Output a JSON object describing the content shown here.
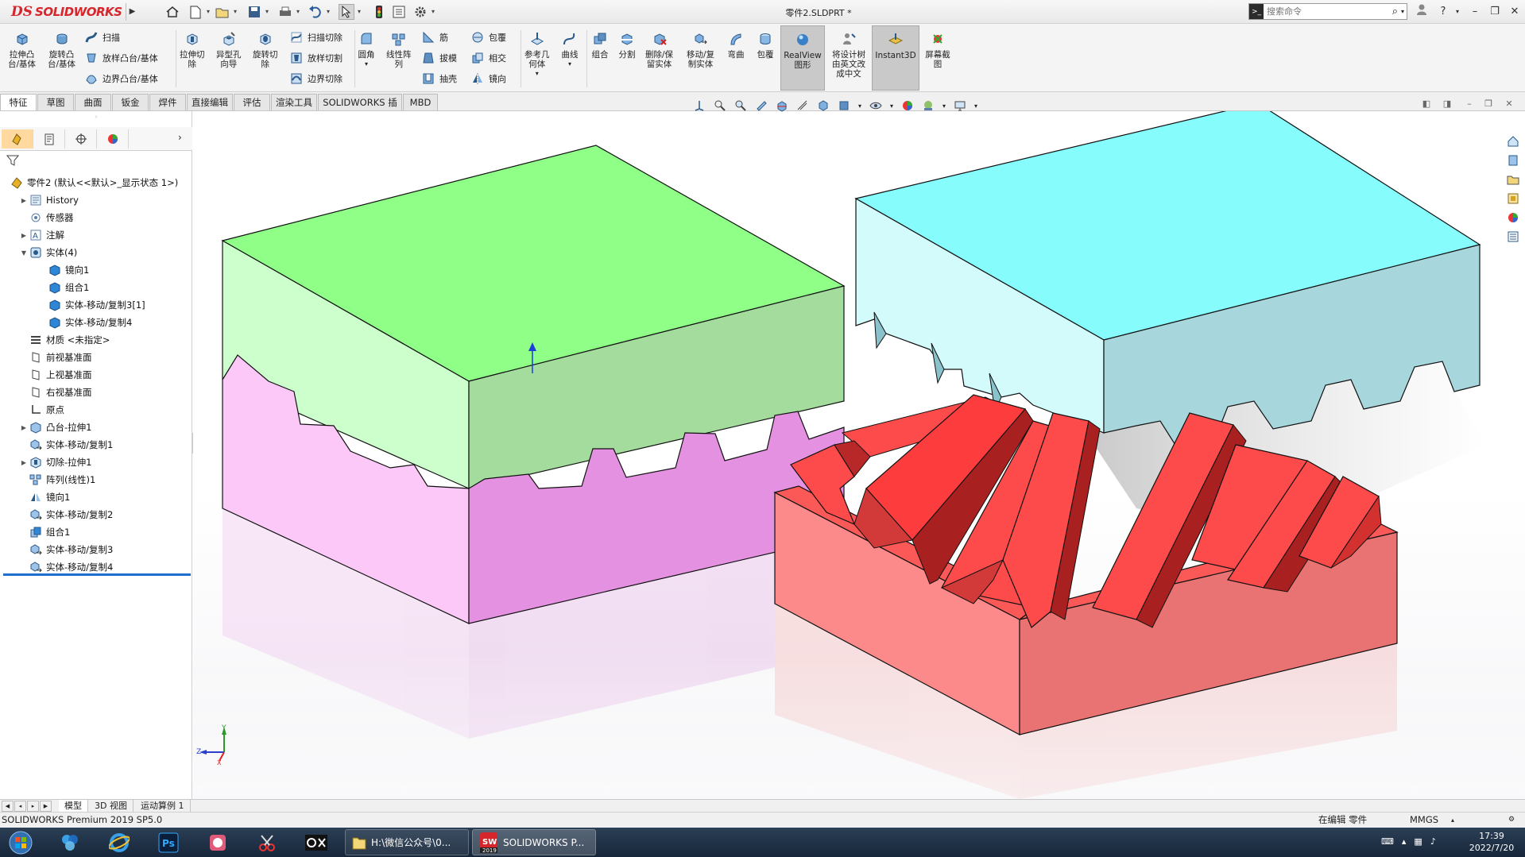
{
  "app": {
    "brand_ds": "DS",
    "brand_name": "SOLIDWORKS",
    "document_title": "零件2.SLDPRT *"
  },
  "search": {
    "placeholder": "搜索命令"
  },
  "commands": {
    "extrude_boss": "拉伸凸\n台/基体",
    "revolve_boss": "旋转凸\n台/基体",
    "sweep": "扫描",
    "loft": "放样凸台/基体",
    "boundary_boss": "边界凸台/基体",
    "extrude_cut": "拉伸切\n除",
    "hole_wizard": "异型孔\n向导",
    "revolve_cut": "旋转切\n除",
    "swept_cut": "扫描切除",
    "lofted_cut": "放样切割",
    "boundary_cut": "边界切除",
    "fillet": "圆角",
    "linear_pattern": "线性阵\n列",
    "rib": "筋",
    "draft": "拔模",
    "shell": "抽壳",
    "wrap": "包覆",
    "intersect": "相交",
    "mirror": "镜向",
    "ref_geometry": "参考几\n何体",
    "curves": "曲线",
    "combine": "组合",
    "split": "分割",
    "delete_keep_body": "删除/保\n留实体",
    "move_copy_body": "移动/复\n制实体",
    "flex": "弯曲",
    "wrap2": "包覆",
    "realview": "RealView\n图形",
    "translate_tree": "将设计树\n由英文改\n成中文",
    "instant3d": "Instant3D",
    "screen_capture": "屏幕截\n图"
  },
  "tabs": [
    "特征",
    "草图",
    "曲面",
    "钣金",
    "焊件",
    "直接编辑",
    "评估",
    "渲染工具",
    "SOLIDWORKS 插件",
    "MBD"
  ],
  "tree": [
    {
      "label": "零件2 (默认<<默认>_显示状态 1>)",
      "icon": "part",
      "indent": 0,
      "expand": ""
    },
    {
      "label": "History",
      "icon": "history",
      "indent": 1,
      "expand": "▶"
    },
    {
      "label": "传感器",
      "icon": "sensor",
      "indent": 1,
      "expand": ""
    },
    {
      "label": "注解",
      "icon": "annotation",
      "indent": 1,
      "expand": "▶"
    },
    {
      "label": "实体(4)",
      "icon": "solid-bodies",
      "indent": 1,
      "expand": "▼"
    },
    {
      "label": "镜向1",
      "icon": "body",
      "indent": 2,
      "expand": ""
    },
    {
      "label": "组合1",
      "icon": "body",
      "indent": 2,
      "expand": ""
    },
    {
      "label": "实体-移动/复制3[1]",
      "icon": "body",
      "indent": 2,
      "expand": ""
    },
    {
      "label": "实体-移动/复制4",
      "icon": "body",
      "indent": 2,
      "expand": ""
    },
    {
      "label": "材质 <未指定>",
      "icon": "material",
      "indent": 1,
      "expand": ""
    },
    {
      "label": "前视基准面",
      "icon": "plane",
      "indent": 1,
      "expand": ""
    },
    {
      "label": "上视基准面",
      "icon": "plane",
      "indent": 1,
      "expand": ""
    },
    {
      "label": "右视基准面",
      "icon": "plane",
      "indent": 1,
      "expand": ""
    },
    {
      "label": "原点",
      "icon": "origin",
      "indent": 1,
      "expand": ""
    },
    {
      "label": "凸台-拉伸1",
      "icon": "extrude",
      "indent": 1,
      "expand": "▶"
    },
    {
      "label": "实体-移动/复制1",
      "icon": "move",
      "indent": 1,
      "expand": ""
    },
    {
      "label": "切除-拉伸1",
      "icon": "cut",
      "indent": 1,
      "expand": "▶"
    },
    {
      "label": "阵列(线性)1",
      "icon": "pattern",
      "indent": 1,
      "expand": ""
    },
    {
      "label": "镜向1",
      "icon": "mirror",
      "indent": 1,
      "expand": ""
    },
    {
      "label": "实体-移动/复制2",
      "icon": "move",
      "indent": 1,
      "expand": ""
    },
    {
      "label": "组合1",
      "icon": "combine",
      "indent": 1,
      "expand": ""
    },
    {
      "label": "实体-移动/复制3",
      "icon": "move",
      "indent": 1,
      "expand": ""
    },
    {
      "label": "实体-移动/复制4",
      "icon": "move",
      "indent": 1,
      "expand": ""
    }
  ],
  "bottom_tabs": [
    "模型",
    "3D 视图",
    "运动算例 1"
  ],
  "status": {
    "product": "SOLIDWORKS Premium 2019 SP5.0",
    "edit_state": "在编辑 零件",
    "units": "MMGS"
  },
  "taskbar": {
    "explorer_window": "H:\\微信公众号\\0...",
    "solidworks_window": "SOLIDWORKS P...",
    "sw_badge_year": "2019"
  },
  "clock": {
    "time": "17:39",
    "date": "2022/7/20"
  },
  "triad": {
    "x": "X",
    "y": "Y",
    "z": "Z"
  },
  "colors": {
    "green_body": "#8fff88",
    "pink_body": "#f7b4f4",
    "cyan_body": "#86fcfd",
    "red_body": "#fd4a4a",
    "brand_red": "#d6262c",
    "selection_blue": "#1f6fd1"
  }
}
